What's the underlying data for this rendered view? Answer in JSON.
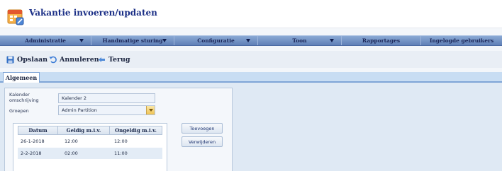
{
  "window": {
    "title": "Vakantie invoeren/updaten",
    "icon": "calendar-edit-icon"
  },
  "menubar": {
    "items": [
      {
        "label": "Administratie",
        "has_dropdown": true
      },
      {
        "label": "Handmatige sturing",
        "has_dropdown": true
      },
      {
        "label": "Configuratie",
        "has_dropdown": true
      },
      {
        "label": "Toon",
        "has_dropdown": true
      },
      {
        "label": "Rapportages",
        "has_dropdown": false
      },
      {
        "label": "Ingelogde gebruikers",
        "has_dropdown": false
      }
    ]
  },
  "toolbar": {
    "save_label": "Opslaan",
    "cancel_label": "Annuleren",
    "back_label": "Terug"
  },
  "tabs": [
    {
      "label": "Algemeen",
      "active": true
    }
  ],
  "form": {
    "calendar_description_label": "Kalender omschrijving",
    "calendar_description_value": "Kalender 2",
    "groups_label": "Groepen",
    "groups_value": "Admin Partition"
  },
  "table": {
    "columns": [
      "Datum",
      "Geldig m.i.v.",
      "Ongeldig m.i.v."
    ],
    "rows": [
      [
        "26-1-2018",
        "12:00",
        "12:00"
      ],
      [
        "2-2-2018",
        "02:00",
        "11:00"
      ]
    ]
  },
  "buttons": {
    "add_label": "Toevoegen",
    "remove_label": "Verwijderen"
  },
  "colors": {
    "title": "#1b2f86",
    "menubar": "#6f8fc4",
    "accent_yellow": "#efc253"
  }
}
